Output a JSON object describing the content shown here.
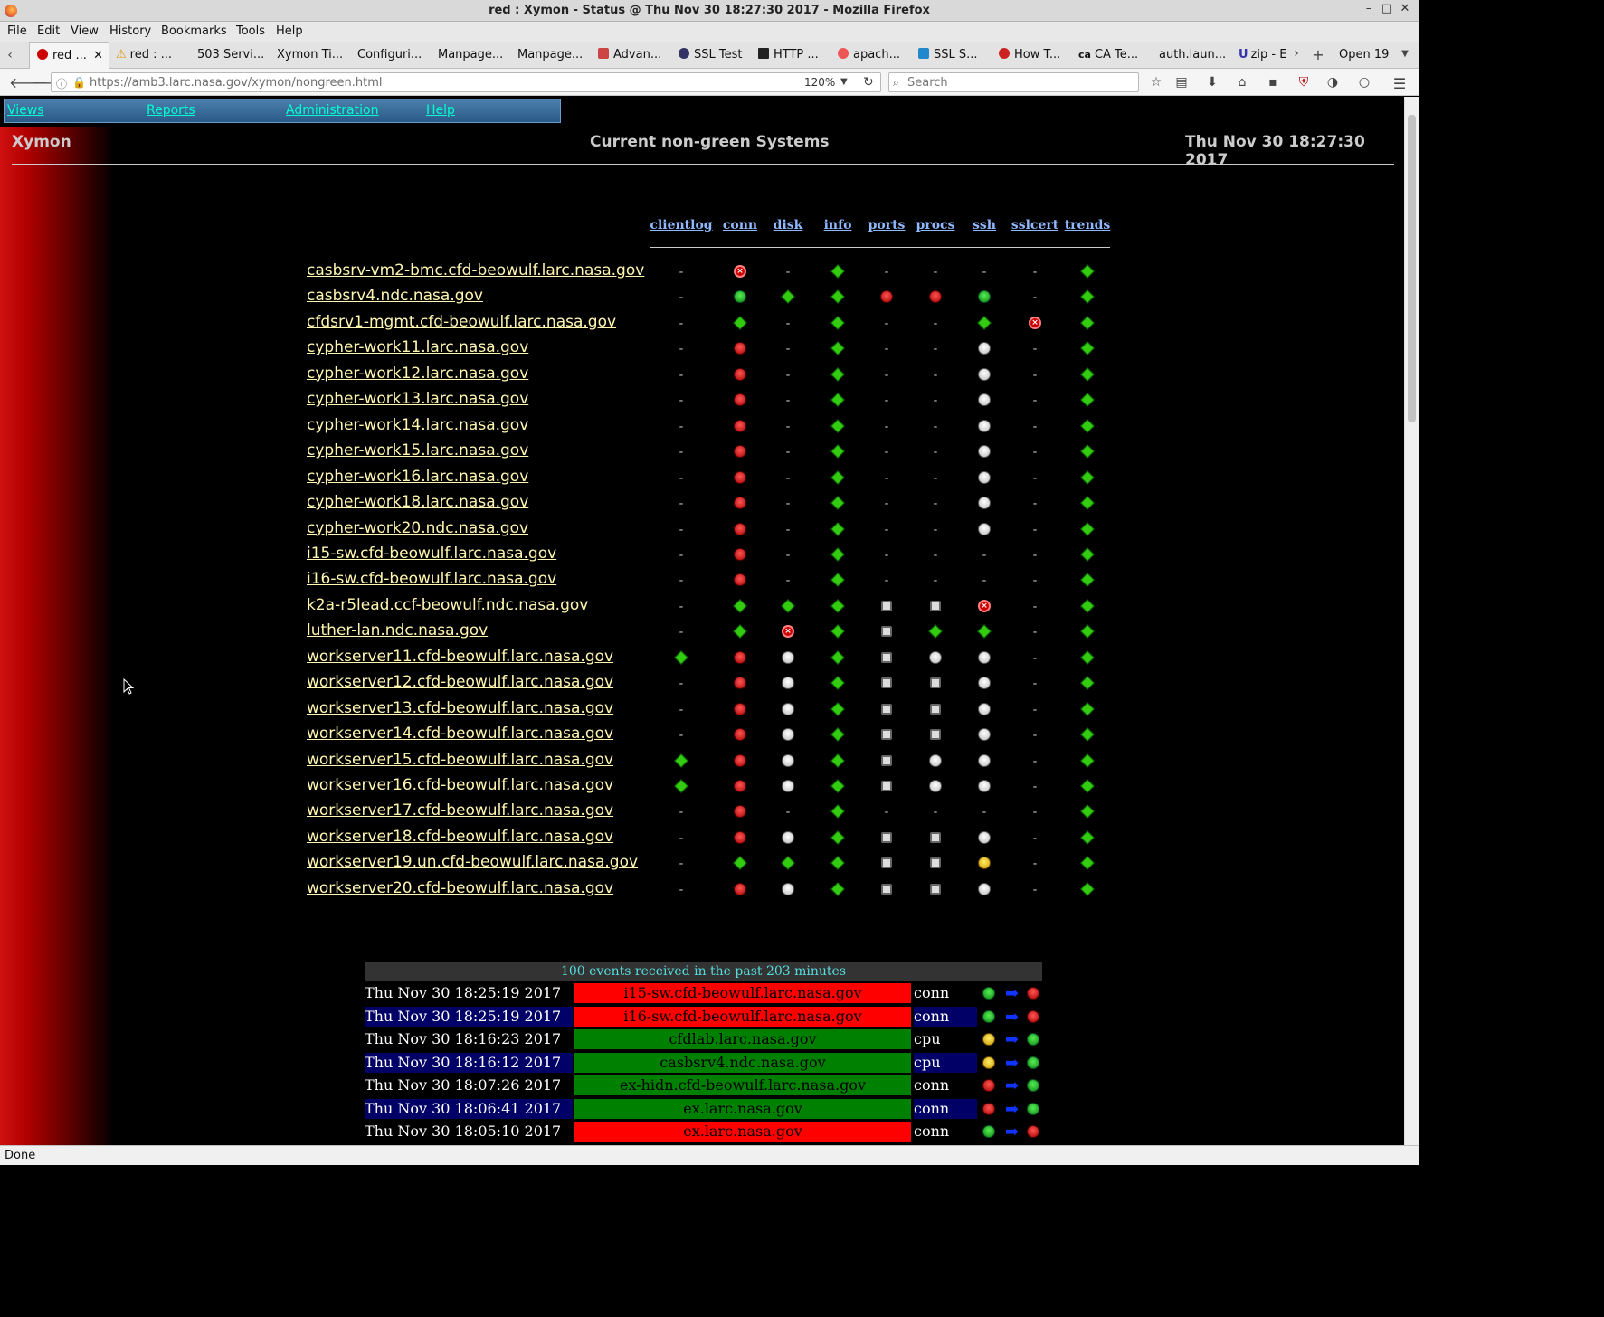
{
  "window": {
    "title": "red : Xymon - Status @ Thu Nov 30 18:27:30 2017 - Mozilla Firefox"
  },
  "menubar": [
    "File",
    "Edit",
    "View",
    "History",
    "Bookmarks",
    "Tools",
    "Help"
  ],
  "tabs": [
    {
      "label": "red ...",
      "active": true
    },
    {
      "label": "red : ..."
    },
    {
      "label": "503 Servi..."
    },
    {
      "label": "Xymon Ti..."
    },
    {
      "label": "Configuri..."
    },
    {
      "label": "Manpage..."
    },
    {
      "label": "Manpage..."
    },
    {
      "label": "Advan..."
    },
    {
      "label": "SSL Test"
    },
    {
      "label": "HTTP ..."
    },
    {
      "label": "apach..."
    },
    {
      "label": "SSL S..."
    },
    {
      "label": "How T..."
    },
    {
      "label": "CA Te..."
    },
    {
      "label": "auth.laun..."
    },
    {
      "label": "zip - E"
    }
  ],
  "tabbar": {
    "open_count": "Open 19"
  },
  "navbar": {
    "url": "https://amb3.larc.nasa.gov/xymon/nongreen.html",
    "zoom": "120%",
    "search_placeholder": "Search"
  },
  "xymon_menu": [
    "Views",
    "Reports",
    "Administration",
    "Help"
  ],
  "header": {
    "left": "Xymon",
    "center": "Current non-green Systems",
    "right": "Thu Nov 30 18:27:30 2017"
  },
  "columns": [
    "clientlog",
    "conn",
    "disk",
    "info",
    "ports",
    "procs",
    "ssh",
    "sslcert",
    "trends"
  ],
  "hosts": [
    {
      "name": "casbsrv-vm2-bmc.cfd-beowulf.larc.nasa.gov",
      "status": [
        "-",
        "redx",
        "-",
        "diamond",
        "-",
        "-",
        "-",
        "-",
        "diamond"
      ]
    },
    {
      "name": "casbsrv4.ndc.nasa.gov",
      "status": [
        "-",
        "green",
        "diamond",
        "diamond",
        "red",
        "red",
        "green",
        "-",
        "diamond"
      ]
    },
    {
      "name": "cfdsrv1-mgmt.cfd-beowulf.larc.nasa.gov",
      "status": [
        "-",
        "diamond",
        "-",
        "diamond",
        "-",
        "-",
        "diamond",
        "redx",
        "diamond"
      ]
    },
    {
      "name": "cypher-work11.larc.nasa.gov",
      "status": [
        "-",
        "red",
        "-",
        "diamond",
        "-",
        "-",
        "white",
        "-",
        "diamond"
      ]
    },
    {
      "name": "cypher-work12.larc.nasa.gov",
      "status": [
        "-",
        "red",
        "-",
        "diamond",
        "-",
        "-",
        "white",
        "-",
        "diamond"
      ]
    },
    {
      "name": "cypher-work13.larc.nasa.gov",
      "status": [
        "-",
        "red",
        "-",
        "diamond",
        "-",
        "-",
        "white",
        "-",
        "diamond"
      ]
    },
    {
      "name": "cypher-work14.larc.nasa.gov",
      "status": [
        "-",
        "red",
        "-",
        "diamond",
        "-",
        "-",
        "white",
        "-",
        "diamond"
      ]
    },
    {
      "name": "cypher-work15.larc.nasa.gov",
      "status": [
        "-",
        "red",
        "-",
        "diamond",
        "-",
        "-",
        "white",
        "-",
        "diamond"
      ]
    },
    {
      "name": "cypher-work16.larc.nasa.gov",
      "status": [
        "-",
        "red",
        "-",
        "diamond",
        "-",
        "-",
        "white",
        "-",
        "diamond"
      ]
    },
    {
      "name": "cypher-work18.larc.nasa.gov",
      "status": [
        "-",
        "red",
        "-",
        "diamond",
        "-",
        "-",
        "white",
        "-",
        "diamond"
      ]
    },
    {
      "name": "cypher-work20.ndc.nasa.gov",
      "status": [
        "-",
        "red",
        "-",
        "diamond",
        "-",
        "-",
        "white",
        "-",
        "diamond"
      ]
    },
    {
      "name": "i15-sw.cfd-beowulf.larc.nasa.gov",
      "status": [
        "-",
        "red",
        "-",
        "diamond",
        "-",
        "-",
        "-",
        "-",
        "diamond"
      ]
    },
    {
      "name": "i16-sw.cfd-beowulf.larc.nasa.gov",
      "status": [
        "-",
        "red",
        "-",
        "diamond",
        "-",
        "-",
        "-",
        "-",
        "diamond"
      ]
    },
    {
      "name": "k2a-r5lead.ccf-beowulf.ndc.nasa.gov",
      "status": [
        "-",
        "diamond",
        "diamond",
        "diamond",
        "blue",
        "blue",
        "redx",
        "-",
        "diamond"
      ]
    },
    {
      "name": "luther-lan.ndc.nasa.gov",
      "status": [
        "-",
        "diamond",
        "redx",
        "diamond",
        "blue",
        "diamond",
        "diamond",
        "-",
        "diamond"
      ]
    },
    {
      "name": "workserver11.cfd-beowulf.larc.nasa.gov",
      "status": [
        "diamond",
        "red",
        "white",
        "diamond",
        "blue",
        "white",
        "white",
        "-",
        "diamond"
      ]
    },
    {
      "name": "workserver12.cfd-beowulf.larc.nasa.gov",
      "status": [
        "-",
        "red",
        "white",
        "diamond",
        "blue",
        "blue",
        "white",
        "-",
        "diamond"
      ]
    },
    {
      "name": "workserver13.cfd-beowulf.larc.nasa.gov",
      "status": [
        "-",
        "red",
        "white",
        "diamond",
        "blue",
        "blue",
        "white",
        "-",
        "diamond"
      ]
    },
    {
      "name": "workserver14.cfd-beowulf.larc.nasa.gov",
      "status": [
        "-",
        "red",
        "white",
        "diamond",
        "blue",
        "blue",
        "white",
        "-",
        "diamond"
      ]
    },
    {
      "name": "workserver15.cfd-beowulf.larc.nasa.gov",
      "status": [
        "diamond",
        "red",
        "white",
        "diamond",
        "blue",
        "white",
        "white",
        "-",
        "diamond"
      ]
    },
    {
      "name": "workserver16.cfd-beowulf.larc.nasa.gov",
      "status": [
        "diamond",
        "red",
        "white",
        "diamond",
        "blue",
        "white",
        "white",
        "-",
        "diamond"
      ]
    },
    {
      "name": "workserver17.cfd-beowulf.larc.nasa.gov",
      "status": [
        "-",
        "red",
        "-",
        "diamond",
        "-",
        "-",
        "-",
        "-",
        "diamond"
      ]
    },
    {
      "name": "workserver18.cfd-beowulf.larc.nasa.gov",
      "status": [
        "-",
        "red",
        "white",
        "diamond",
        "blue",
        "blue",
        "white",
        "-",
        "diamond"
      ]
    },
    {
      "name": "workserver19.un.cfd-beowulf.larc.nasa.gov",
      "status": [
        "-",
        "diamond",
        "diamond",
        "diamond",
        "blue",
        "blue",
        "yellow",
        "-",
        "diamond"
      ]
    },
    {
      "name": "workserver20.cfd-beowulf.larc.nasa.gov",
      "status": [
        "-",
        "red",
        "white",
        "diamond",
        "blue",
        "blue",
        "white",
        "-",
        "diamond"
      ]
    }
  ],
  "events": {
    "caption": "100 events received in the past 203 minutes",
    "rows": [
      {
        "time": "Thu Nov 30 18:25:19 2017",
        "host": "i15-sw.cfd-beowulf.larc.nasa.gov",
        "color": "#ff0000",
        "test": "conn",
        "from": "green",
        "to": "red"
      },
      {
        "time": "Thu Nov 30 18:25:19 2017",
        "host": "i16-sw.cfd-beowulf.larc.nasa.gov",
        "color": "#ff0000",
        "test": "conn",
        "from": "green",
        "to": "red"
      },
      {
        "time": "Thu Nov 30 18:16:23 2017",
        "host": "cfdlab.larc.nasa.gov",
        "color": "#008000",
        "test": "cpu",
        "from": "yellow",
        "to": "green"
      },
      {
        "time": "Thu Nov 30 18:16:12 2017",
        "host": "casbsrv4.ndc.nasa.gov",
        "color": "#008000",
        "test": "cpu",
        "from": "yellow",
        "to": "green"
      },
      {
        "time": "Thu Nov 30 18:07:26 2017",
        "host": "ex-hidn.cfd-beowulf.larc.nasa.gov",
        "color": "#008000",
        "test": "conn",
        "from": "red",
        "to": "green"
      },
      {
        "time": "Thu Nov 30 18:06:41 2017",
        "host": "ex.larc.nasa.gov",
        "color": "#008000",
        "test": "conn",
        "from": "red",
        "to": "green"
      },
      {
        "time": "Thu Nov 30 18:05:10 2017",
        "host": "ex.larc.nasa.gov",
        "color": "#ff0000",
        "test": "conn",
        "from": "green",
        "to": "red"
      }
    ]
  },
  "statusbar": {
    "text": "Done"
  }
}
